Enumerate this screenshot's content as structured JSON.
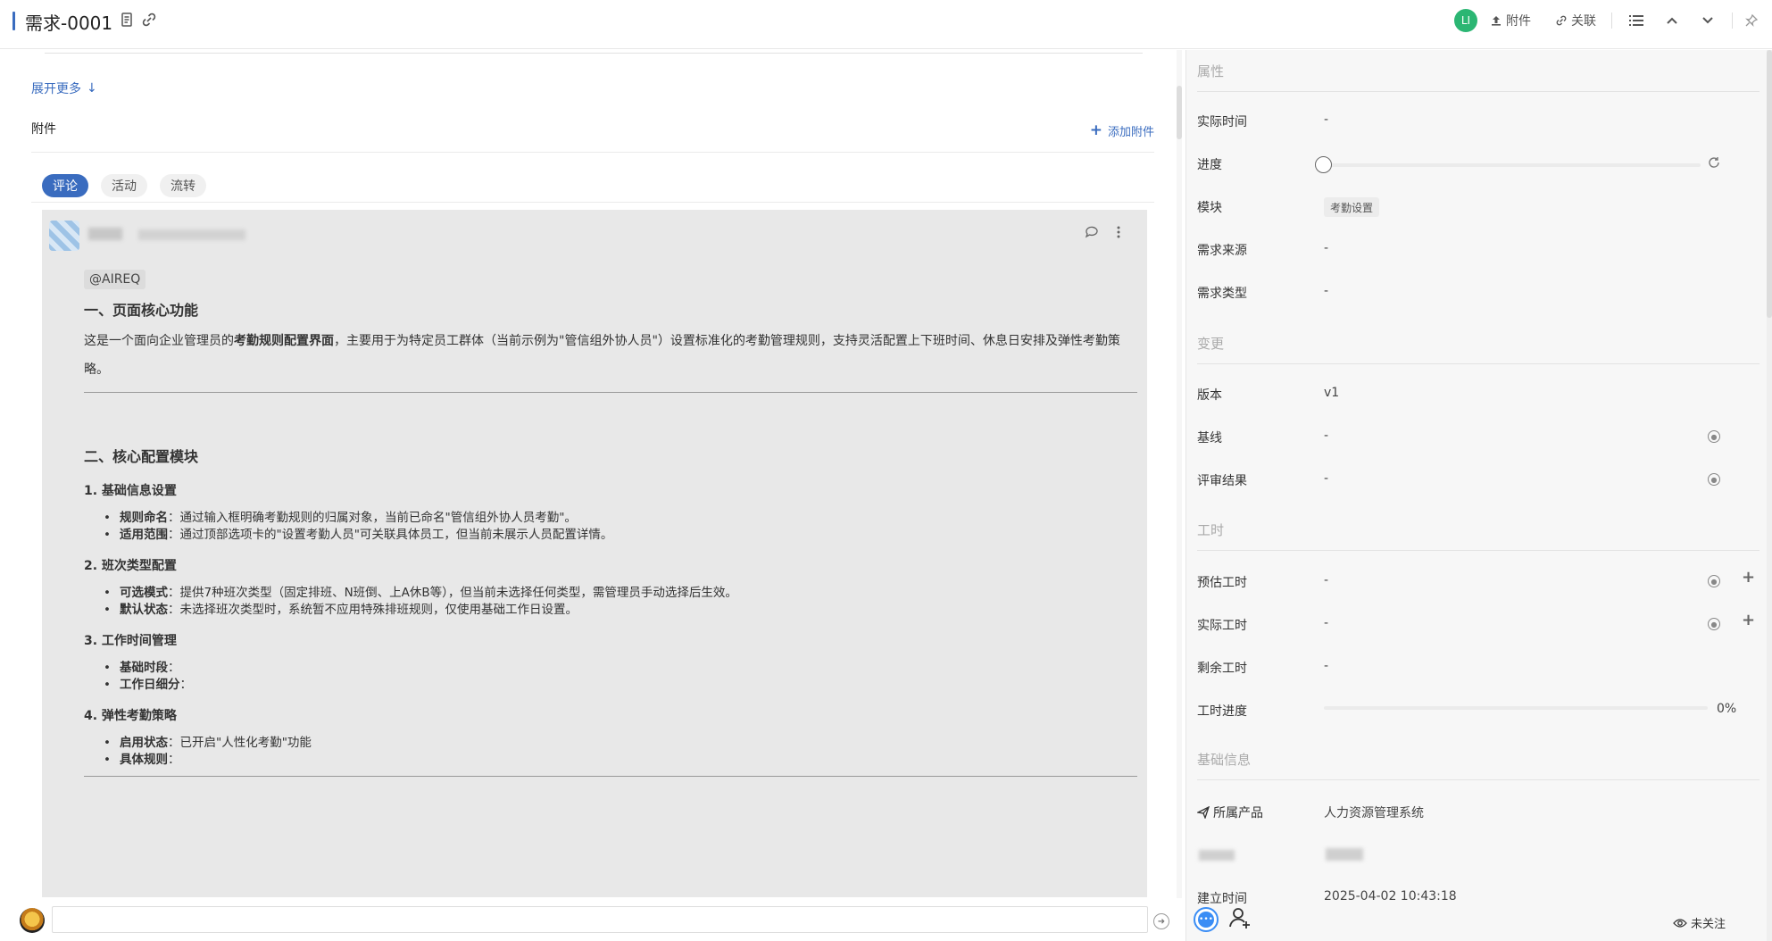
{
  "header": {
    "title": "需求-0001",
    "avatar_initials": "LI",
    "attach_label": "附件",
    "link_label": "关联"
  },
  "main": {
    "expand_more": "展开更多",
    "attachments_label": "附件",
    "add_attachment": "添加附件",
    "tabs": [
      {
        "label": "评论",
        "active": true
      },
      {
        "label": "活动",
        "active": false
      },
      {
        "label": "流转",
        "active": false
      }
    ],
    "comment": {
      "mention": "@AIREQ",
      "h1": "一、页面核心功能",
      "intro_prefix": "这是一个面向企业管理员的",
      "intro_bold": "考勤规则配置界面",
      "intro_suffix": "，主要用于为特定员工群体（当前示例为\"管信组外协人员\"）设置标准化的考勤管理规则，支持灵活配置上下班时间、休息日安排及弹性考勤策",
      "intro_tail": "略。",
      "h2": "二、核心配置模块",
      "sections": [
        {
          "title": "1. 基础信息设置",
          "items": [
            {
              "label": "规则命名",
              "text": "：通过输入框明确考勤规则的归属对象，当前已命名\"管信组外协人员考勤\"。"
            },
            {
              "label": "适用范围",
              "text": "：通过顶部选项卡的\"设置考勤人员\"可关联具体员工，但当前未展示人员配置详情。"
            }
          ]
        },
        {
          "title": "2. 班次类型配置",
          "items": [
            {
              "label": "可选模式",
              "text": "：提供7种班次类型（固定排班、N班倒、上A休B等），但当前未选择任何类型，需管理员手动选择后生效。"
            },
            {
              "label": "默认状态",
              "text": "：未选择班次类型时，系统暂不应用特殊排班规则，仅使用基础工作日设置。"
            }
          ]
        },
        {
          "title": "3. 工作时间管理",
          "items": [
            {
              "label": "基础时段",
              "text": "："
            },
            {
              "label": "工作日细分",
              "text": "："
            }
          ]
        },
        {
          "title": "4. 弹性考勤策略",
          "items": [
            {
              "label": "启用状态",
              "text": "：已开启\"人性化考勤\"功能"
            },
            {
              "label": "具体规则",
              "text": "："
            }
          ]
        }
      ]
    }
  },
  "panel": {
    "sections": {
      "properties": "属性",
      "changes": "变更",
      "workhours": "工时",
      "basic": "基础信息"
    },
    "props": {
      "actual_time": {
        "label": "实际时间",
        "value": "-"
      },
      "progress": {
        "label": "进度",
        "value": 0
      },
      "module": {
        "label": "模块",
        "value": "考勤设置"
      },
      "source": {
        "label": "需求来源",
        "value": "-"
      },
      "type": {
        "label": "需求类型",
        "value": "-"
      },
      "version": {
        "label": "版本",
        "value": "v1"
      },
      "baseline": {
        "label": "基线",
        "value": "-"
      },
      "review": {
        "label": "评审结果",
        "value": "-"
      },
      "est_hours": {
        "label": "预估工时",
        "value": "-"
      },
      "act_hours": {
        "label": "实际工时",
        "value": "-"
      },
      "remain_hours": {
        "label": "剩余工时",
        "value": "-"
      },
      "hours_progress": {
        "label": "工时进度",
        "value": "0%",
        "fraction": 0
      },
      "product": {
        "label": "所属产品",
        "value": "人力资源管理系统"
      },
      "created": {
        "label": "建立时间",
        "value": "2025-04-02 10:43:18"
      }
    },
    "follow_label": "未关注"
  },
  "colors": {
    "accent": "#3a6cbf",
    "avatar": "#2bb673",
    "panel_bg": "#f7f7f7",
    "comment_bg": "#e8e8e8"
  }
}
